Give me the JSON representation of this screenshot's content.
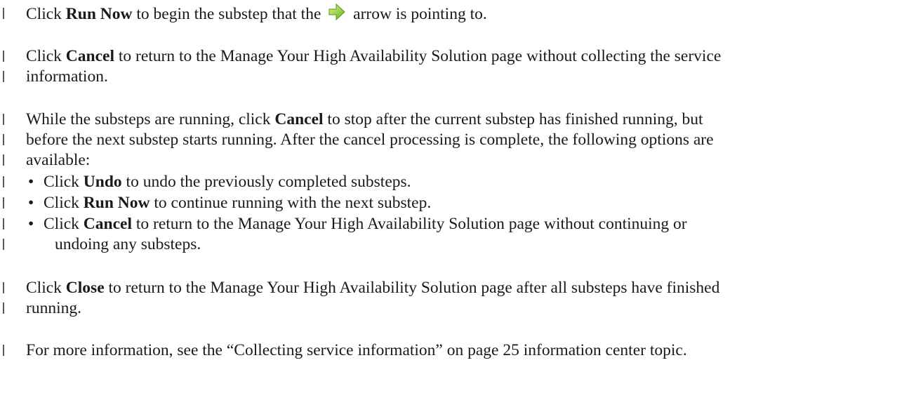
{
  "para1": {
    "pre": "Click ",
    "bold": "Run Now",
    "mid": " to begin the substep that the ",
    "post": " arrow is pointing to."
  },
  "para2": {
    "pre": "Click ",
    "bold": "Cancel",
    "line1_rest": " to return to the Manage Your High Availability Solution page without collecting the service",
    "line2": "information."
  },
  "para3": {
    "line1_pre": "While the substeps are running, click ",
    "line1_bold": "Cancel",
    "line1_rest": " to stop after the current substep has finished running, but",
    "line2": "before the next substep starts running. After the cancel processing is complete, the following options are",
    "line3": "available:"
  },
  "bullets": [
    {
      "marker": "•",
      "pre": "Click ",
      "bold": "Undo",
      "rest": " to undo the previously completed substeps."
    },
    {
      "marker": "•",
      "pre": "Click ",
      "bold": "Run Now",
      "rest": " to continue running with the next substep."
    },
    {
      "marker": "•",
      "pre": "Click ",
      "bold": "Cancel",
      "rest": " to return to the Manage Your High Availability Solution page without continuing or",
      "line2": "undoing any substeps."
    }
  ],
  "para4": {
    "pre": "Click ",
    "bold": "Close",
    "line1_rest": " to return to the Manage Your High Availability Solution page after all substeps have finished",
    "line2": "running."
  },
  "para5": {
    "pre": "For more information, see the ",
    "link": "“Collecting service information” on page 25",
    "post": " information center topic."
  },
  "icons": {
    "arrow": "green-right-arrow-icon"
  },
  "colors": {
    "arrow_fill": "#7cc43a",
    "arrow_light": "#e7f06a"
  }
}
